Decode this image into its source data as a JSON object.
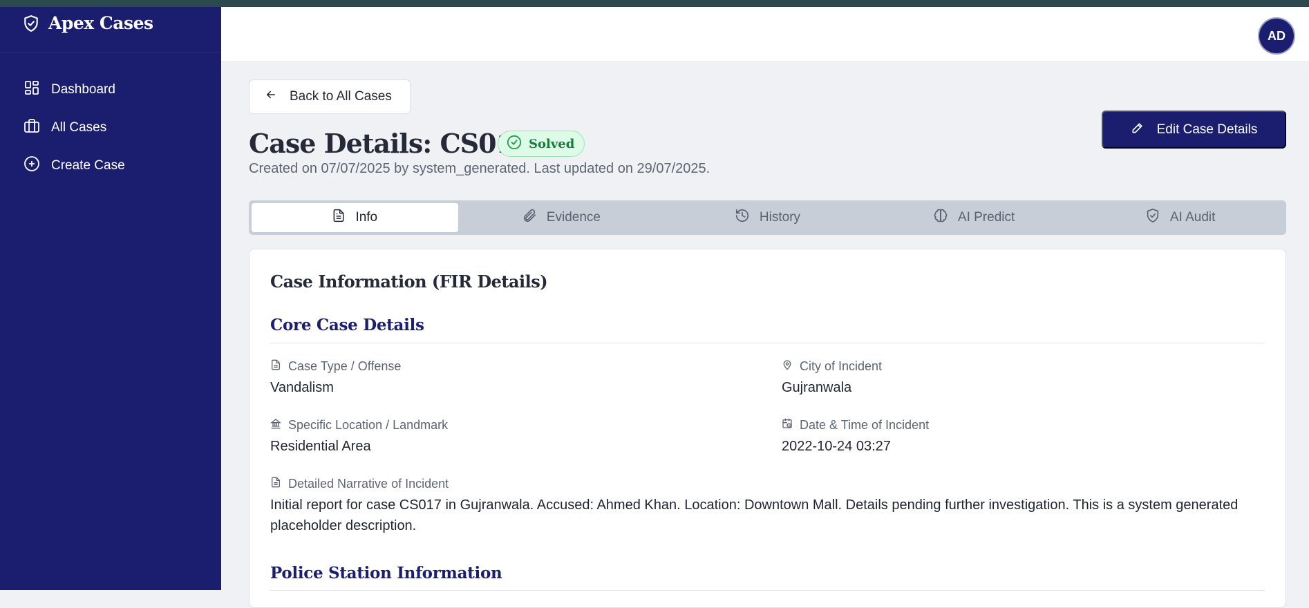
{
  "brand": {
    "name": "Apex Cases"
  },
  "sidebar": {
    "items": [
      {
        "label": "Dashboard",
        "icon": "dashboard-icon"
      },
      {
        "label": "All Cases",
        "icon": "briefcase-icon"
      },
      {
        "label": "Create Case",
        "icon": "plus-circle-icon"
      }
    ]
  },
  "header": {
    "avatar_initials": "AD"
  },
  "page": {
    "back_label": "Back to All Cases",
    "title": "Case Details: CS017",
    "status": "Solved",
    "subtitle": "Created on 07/07/2025 by system_generated. Last updated on 29/07/2025.",
    "edit_label": "Edit Case Details"
  },
  "tabs": [
    {
      "label": "Info",
      "icon": "document-icon",
      "active": true
    },
    {
      "label": "Evidence",
      "icon": "paperclip-icon",
      "active": false
    },
    {
      "label": "History",
      "icon": "history-icon",
      "active": false
    },
    {
      "label": "AI Predict",
      "icon": "brain-icon",
      "active": false
    },
    {
      "label": "AI Audit",
      "icon": "shield-check-icon",
      "active": false
    }
  ],
  "card": {
    "title": "Case Information (FIR Details)",
    "core_heading": "Core Case Details",
    "police_heading": "Police Station Information",
    "fields": {
      "case_type": {
        "label": "Case Type / Offense",
        "value": "Vandalism"
      },
      "city": {
        "label": "City of Incident",
        "value": "Gujranwala"
      },
      "location": {
        "label": "Specific Location / Landmark",
        "value": "Residential Area"
      },
      "datetime": {
        "label": "Date & Time of Incident",
        "value": "2022-10-24 03:27"
      },
      "narrative": {
        "label": "Detailed Narrative of Incident",
        "value": "Initial report for case CS017 in Gujranwala. Accused: Ahmed Khan. Location: Downtown Mall. Details pending further investigation. This is a system generated placeholder description."
      }
    }
  },
  "colors": {
    "sidebar": "#1b1e6e",
    "accent": "#1b1e6e",
    "solved": "#177b3c"
  }
}
